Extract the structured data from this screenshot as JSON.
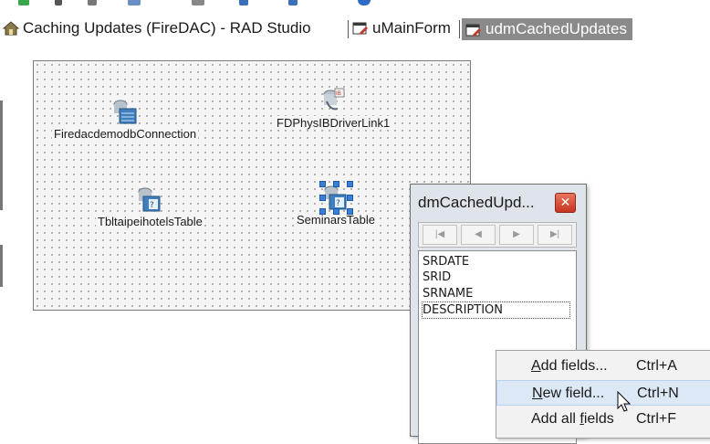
{
  "tabs": [
    {
      "label": "Caching Updates (FireDAC) - RAD Studio",
      "icon": "project-icon",
      "active": false
    },
    {
      "label": "uMainForm",
      "icon": "form-unit-icon",
      "active": false
    },
    {
      "label": "udmCachedUpdates",
      "icon": "form-unit-icon",
      "active": true
    }
  ],
  "components": [
    {
      "label": "FiredacdemodbConnection",
      "icon": "connection-icon"
    },
    {
      "label": "FDPhysIBDriverLink1",
      "icon": "driver-link-icon"
    },
    {
      "label": "TbltaipeihotelsTable",
      "icon": "table-icon"
    },
    {
      "label": "SeminarsTable",
      "icon": "table-icon",
      "selected": true
    }
  ],
  "fields_editor": {
    "title": "dmCachedUpd...",
    "close_glyph": "✕",
    "nav_buttons": [
      "first-record",
      "prior-record",
      "next-record",
      "last-record"
    ],
    "fields": [
      "SRDATE",
      "SRID",
      "SRNAME",
      "DESCRIPTION"
    ],
    "focused_field": "DESCRIPTION"
  },
  "context_menu": {
    "items": [
      {
        "accel": "A",
        "rest": "dd fields...",
        "shortcut": "Ctrl+A"
      },
      {
        "accel": "N",
        "rest": "ew field...",
        "shortcut": "Ctrl+N",
        "hover": true
      },
      {
        "pre": "Add all ",
        "accel": "f",
        "post": "ields",
        "shortcut": "Ctrl+F"
      }
    ]
  },
  "colors": {
    "active_tab_bg": "#8a8a8a",
    "menu_hover": "#dce8f6",
    "selection_handle": "#3a7fd5",
    "close_button": "#c8341e"
  }
}
